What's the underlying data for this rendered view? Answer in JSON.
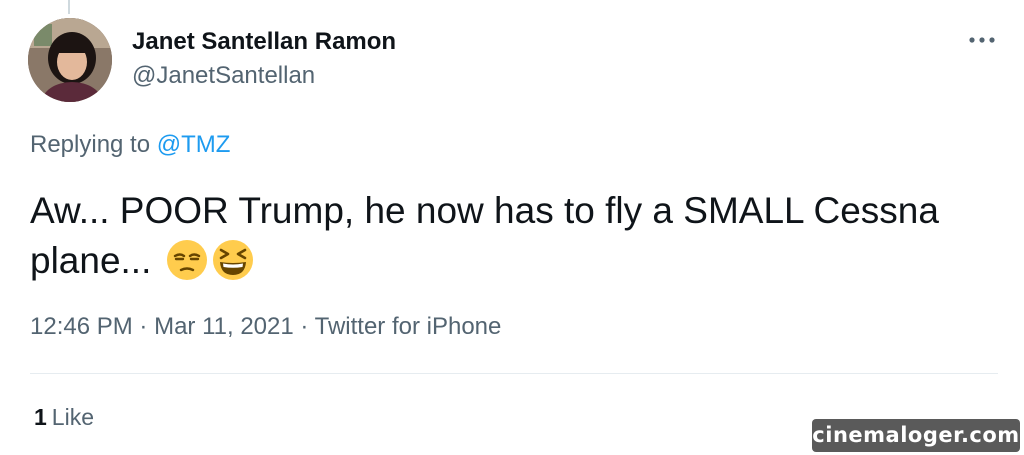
{
  "tweet": {
    "author": {
      "display_name": "Janet Santellan Ramon",
      "handle": "@JanetSantellan"
    },
    "reply": {
      "prefix": "Replying to",
      "mention": "@TMZ"
    },
    "text": "Aw... POOR Trump, he now has to fly a SMALL Cessna plane...",
    "emojis": [
      "unamused-face-emoji",
      "grinning-squinting-face-emoji"
    ],
    "time": "12:46 PM",
    "separator": "·",
    "date": "Mar 11, 2021",
    "source": "Twitter for iPhone",
    "likes": {
      "count": "1",
      "label": "Like"
    },
    "more_icon": "more-horizontal-icon"
  },
  "watermark": "cinemaloger.com",
  "colors": {
    "text_primary": "#0f1419",
    "text_secondary": "#536471",
    "accent": "#1d9bf0",
    "emoji_yellow": "#ffcc4d",
    "watermark_bg": "#5a5a5a"
  }
}
